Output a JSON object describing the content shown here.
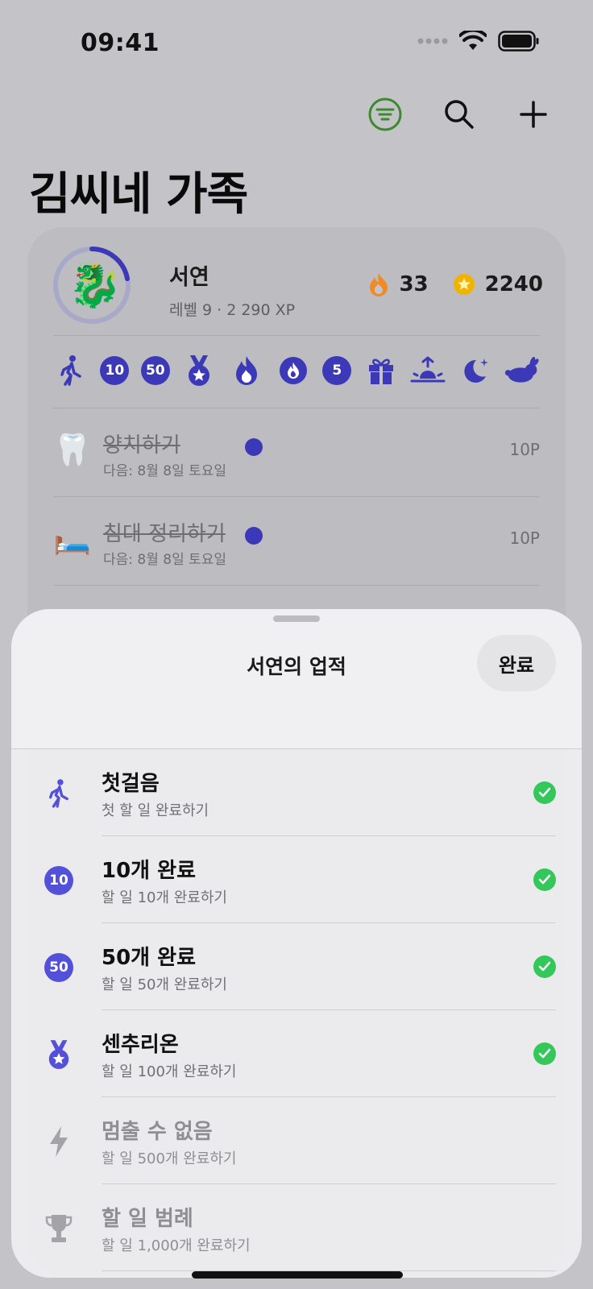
{
  "status_bar": {
    "time": "09:41"
  },
  "page": {
    "title": "김씨네 가족",
    "toolbar": {
      "filter_icon": "filter-icon",
      "search_icon": "search-icon",
      "add_icon": "plus-icon"
    }
  },
  "member": {
    "name": "서연",
    "avatar": "🐉",
    "level_text": "레벨 9 · 2 290 XP",
    "streak": "33",
    "coins": "2240"
  },
  "badges": [
    {
      "kind": "glyph",
      "icon": "walking-icon"
    },
    {
      "kind": "number",
      "label": "10"
    },
    {
      "kind": "number",
      "label": "50"
    },
    {
      "kind": "glyph",
      "icon": "medal-icon"
    },
    {
      "kind": "glyph",
      "icon": "flame-icon"
    },
    {
      "kind": "glyph",
      "icon": "flame-circle-icon"
    },
    {
      "kind": "number",
      "label": "5"
    },
    {
      "kind": "glyph",
      "icon": "gift-icon"
    },
    {
      "kind": "glyph",
      "icon": "sunrise-icon"
    },
    {
      "kind": "glyph",
      "icon": "moon-stars-icon"
    },
    {
      "kind": "glyph",
      "icon": "rabbit-icon"
    }
  ],
  "tasks": [
    {
      "emoji": "🦷",
      "title": "양치하기",
      "next": "다음: 8월 8일 토요일",
      "points": "10P"
    },
    {
      "emoji": "🛏️",
      "title": "침대 정리하기",
      "next": "다음: 8월 8일 토요일",
      "points": "10P"
    }
  ],
  "sheet": {
    "title": "서연의 업적",
    "done_label": "완료",
    "achievements": [
      {
        "icon": "walking-icon",
        "number": "",
        "title": "첫걸음",
        "subtitle": "첫 할 일 완료하기",
        "completed": true
      },
      {
        "icon": "number-badge-icon",
        "number": "10",
        "title": "10개 완료",
        "subtitle": "할 일 10개 완료하기",
        "completed": true
      },
      {
        "icon": "number-badge-icon",
        "number": "50",
        "title": "50개 완료",
        "subtitle": "할 일 50개 완료하기",
        "completed": true
      },
      {
        "icon": "medal-icon",
        "number": "",
        "title": "센추리온",
        "subtitle": "할 일 100개 완료하기",
        "completed": true
      },
      {
        "icon": "bolt-icon",
        "number": "",
        "title": "멈출 수 없음",
        "subtitle": "할 일 500개 완료하기",
        "completed": false
      },
      {
        "icon": "trophy-icon",
        "number": "",
        "title": "할 일 범례",
        "subtitle": "할 일 1,000개 완료하기",
        "completed": false
      }
    ]
  },
  "colors": {
    "accent": "#5350d9",
    "badge": "#3c39b8",
    "check": "#34c759",
    "flame": "#f08a24",
    "coin": "#f0b400"
  }
}
